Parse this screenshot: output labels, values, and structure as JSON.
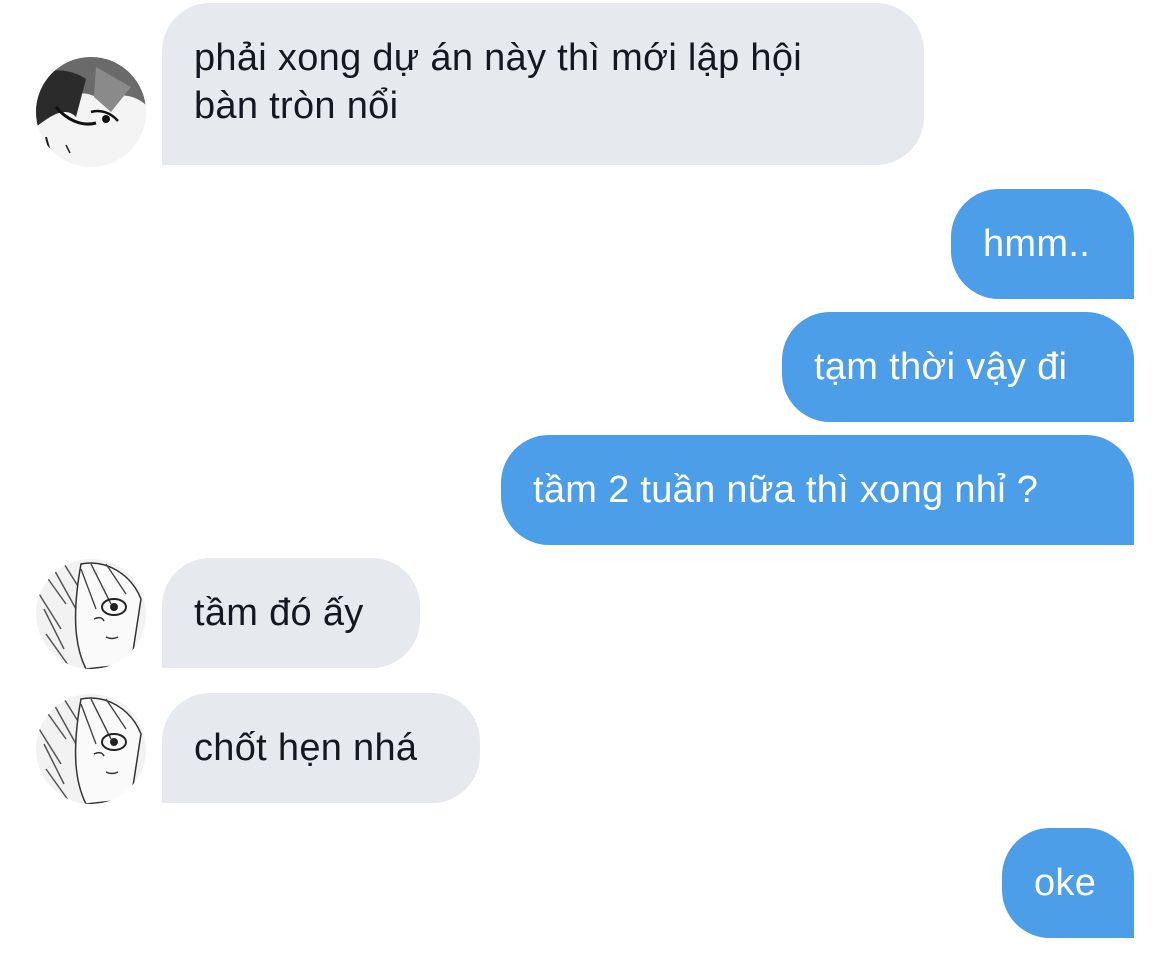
{
  "conversation": {
    "messages": [
      {
        "sender": "them",
        "text_lines": [
          "phải xong dự án này thì mới lập hội",
          "bàn tròn nổi"
        ],
        "avatar": "avatar-dark-hair-icon"
      },
      {
        "sender": "me",
        "text": "hmm.."
      },
      {
        "sender": "me",
        "text": "tạm thời vậy đi"
      },
      {
        "sender": "me",
        "text": "tầm 2 tuần nữa thì xong nhỉ ?"
      },
      {
        "sender": "them",
        "text": "tầm đó ấy",
        "avatar": "avatar-sketch-face-icon"
      },
      {
        "sender": "them",
        "text": "chốt hẹn nhá",
        "avatar": "avatar-sketch-face-icon"
      },
      {
        "sender": "me",
        "text": "oke"
      }
    ]
  },
  "colors": {
    "background": "#ffffff",
    "incoming_bubble": "#e6eaef",
    "incoming_text": "#141823",
    "outgoing_bubble": "#4d9ee9",
    "outgoing_text": "#ffffff"
  }
}
